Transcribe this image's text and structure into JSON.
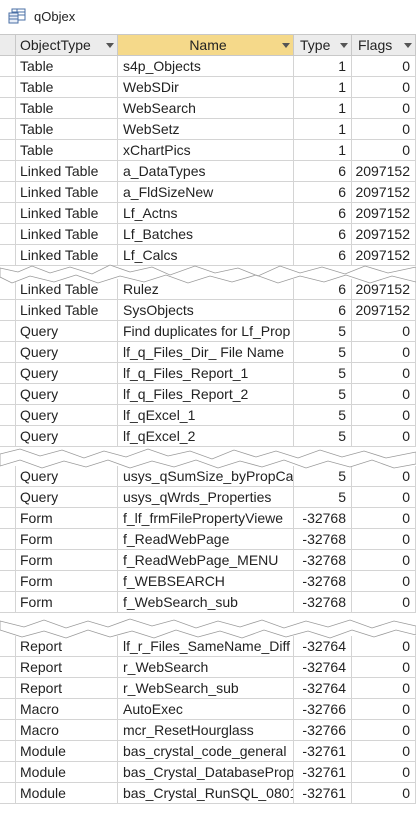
{
  "window": {
    "title": "qObjex"
  },
  "columns": [
    "ObjectType",
    "Name",
    "Type",
    "Flags"
  ],
  "sections": [
    {
      "rows": [
        [
          "Table",
          "s4p_Objects",
          "1",
          "0"
        ],
        [
          "Table",
          "WebSDir",
          "1",
          "0"
        ],
        [
          "Table",
          "WebSearch",
          "1",
          "0"
        ],
        [
          "Table",
          "WebSetz",
          "1",
          "0"
        ],
        [
          "Table",
          "xChartPics",
          "1",
          "0"
        ],
        [
          "Linked  Table",
          "a_DataTypes",
          "6",
          "2097152"
        ],
        [
          "Linked  Table",
          "a_FldSizeNew",
          "6",
          "2097152"
        ],
        [
          "Linked  Table",
          "Lf_Actns",
          "6",
          "2097152"
        ],
        [
          "Linked  Table",
          "Lf_Batches",
          "6",
          "2097152"
        ],
        [
          "Linked  Table",
          "Lf_Calcs",
          "6",
          "2097152"
        ]
      ]
    },
    {
      "rows": [
        [
          "Linked  Table",
          "Rulez",
          "6",
          "2097152"
        ],
        [
          "Linked  Table",
          "SysObjects",
          "6",
          "2097152"
        ],
        [
          "Query",
          "Find duplicates for Lf_Prop",
          "5",
          "0"
        ],
        [
          "Query",
          "lf_q_Files_Dir_ File Name",
          "5",
          "0"
        ],
        [
          "Query",
          "lf_q_Files_Report_1",
          "5",
          "0"
        ],
        [
          "Query",
          "lf_q_Files_Report_2",
          "5",
          "0"
        ],
        [
          "Query",
          "lf_qExcel_1",
          "5",
          "0"
        ],
        [
          "Query",
          "lf_qExcel_2",
          "5",
          "0"
        ]
      ]
    },
    {
      "rows": [
        [
          "Query",
          "usys_qSumSize_byPropCat",
          "5",
          "0"
        ],
        [
          "Query",
          "usys_qWrds_Properties",
          "5",
          "0"
        ],
        [
          "Form",
          "f_lf_frmFilePropertyViewe",
          "-32768",
          "0"
        ],
        [
          "Form",
          "f_ReadWebPage",
          "-32768",
          "0"
        ],
        [
          "Form",
          "f_ReadWebPage_MENU",
          "-32768",
          "0"
        ],
        [
          "Form",
          "f_WEBSEARCH",
          "-32768",
          "0"
        ],
        [
          "Form",
          "f_WebSearch_sub",
          "-32768",
          "0"
        ]
      ]
    },
    {
      "rows": [
        [
          "Report",
          "lf_r_Files_SameName_Diff",
          "-32764",
          "0"
        ],
        [
          "Report",
          "r_WebSearch",
          "-32764",
          "0"
        ],
        [
          "Report",
          "r_WebSearch_sub",
          "-32764",
          "0"
        ],
        [
          "Macro",
          "AutoExec",
          "-32766",
          "0"
        ],
        [
          "Macro",
          "mcr_ResetHourglass",
          "-32766",
          "0"
        ],
        [
          "Module",
          "bas_crystal_code_general",
          "-32761",
          "0"
        ],
        [
          "Module",
          "bas_Crystal_DatabaseProp",
          "-32761",
          "0"
        ],
        [
          "Module",
          "bas_Crystal_RunSQL_0801",
          "-32761",
          "0"
        ]
      ]
    }
  ],
  "icons": {
    "title": "query-datasheet-icon",
    "sort": "sort-arrow-icon"
  },
  "colors": {
    "sorted_header": "#f5d98a",
    "header_bg": "#ececec",
    "grid": "#d4d4d4"
  }
}
